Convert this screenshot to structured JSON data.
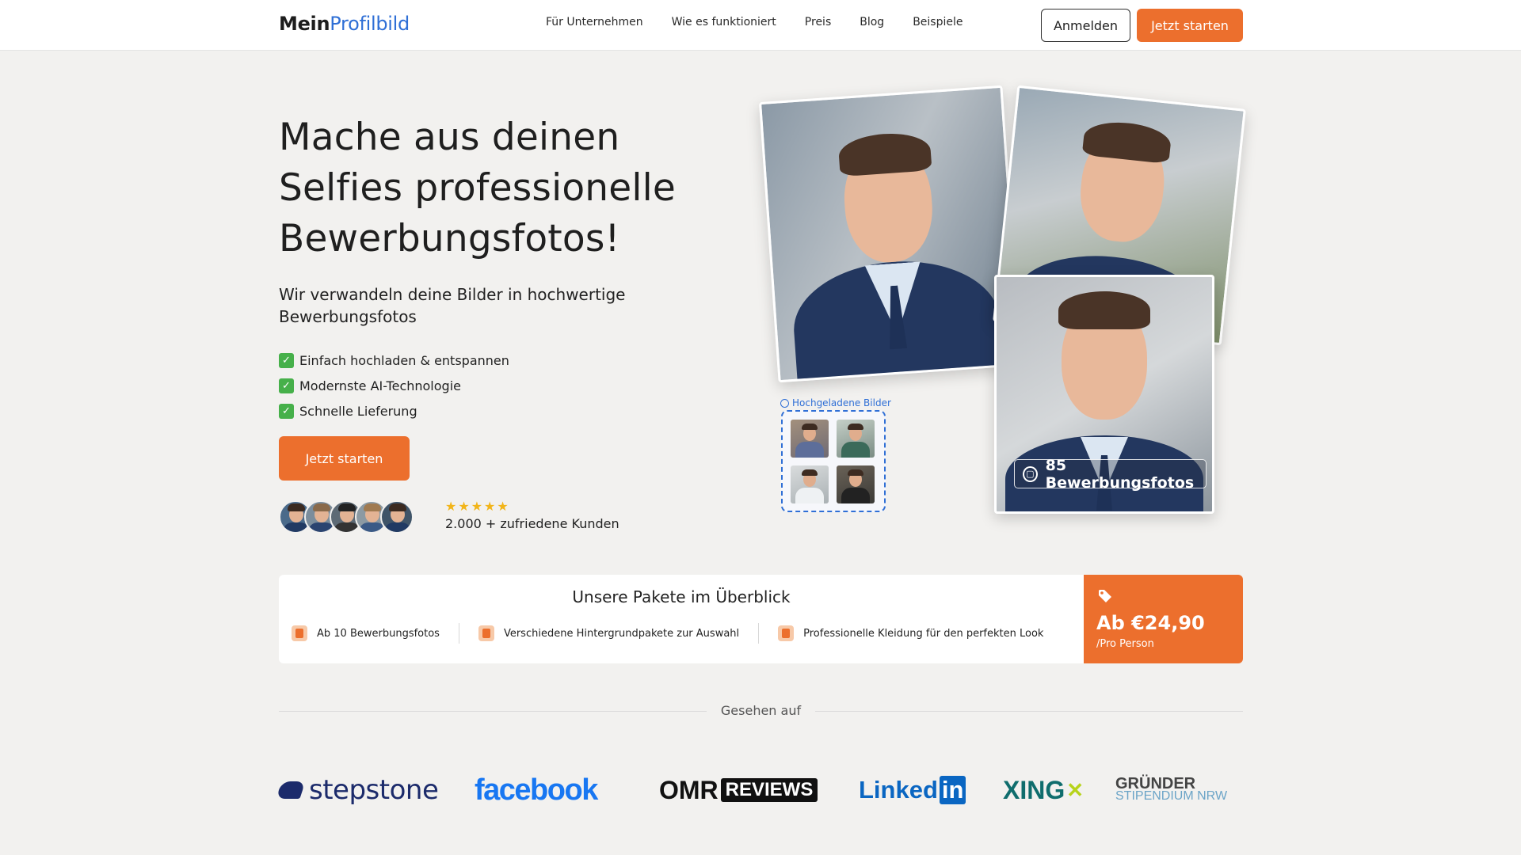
{
  "header": {
    "logo_part1": "Mein",
    "logo_part2": "Profilbild",
    "nav": [
      {
        "label": "Für Unternehmen"
      },
      {
        "label": "Wie es funktioniert"
      },
      {
        "label": "Preis"
      },
      {
        "label": "Blog"
      },
      {
        "label": "Beispiele"
      }
    ],
    "login_label": "Anmelden",
    "start_label": "Jetzt starten"
  },
  "hero": {
    "title": "Mache aus deinen Selfies professionelle Bewerbungsfotos!",
    "subtitle": "Wir verwandeln deine Bilder in hochwertige Bewerbungsfotos",
    "features": [
      {
        "icon": "checkmark-icon",
        "label": "Einfach hochladen & entspannen"
      },
      {
        "icon": "checkmark-icon",
        "label": "Modernste AI-Technologie"
      },
      {
        "icon": "checkmark-icon",
        "label": "Schnelle Lieferung"
      }
    ],
    "cta_label": "Jetzt starten",
    "rating_stars": 5,
    "rating_text": "2.000 + zufriedene Kunden"
  },
  "collage": {
    "uploads_label": "Hochgeladene Bilder",
    "result_badge": "85 Bewerbungsfotos"
  },
  "packages": {
    "title": "Unsere Pakete im Überblick",
    "items": [
      {
        "icon": "person-icon",
        "label": "Ab 10 Bewerbungsfotos"
      },
      {
        "icon": "backgrounds-icon",
        "label": "Verschiedene Hintergrundpakete zur Auswahl"
      },
      {
        "icon": "clothing-icon",
        "label": "Professionelle Kleidung für den perfekten Look"
      }
    ],
    "price": "Ab €24,90",
    "price_unit": "/Pro Person"
  },
  "seen_on": {
    "label": "Gesehen auf",
    "logos": {
      "stepstone": "stepstone",
      "facebook": "facebook",
      "omr": "OMR",
      "omr_reviews": "REVIEWS",
      "linkedin": "Linked",
      "linkedin_in": "in",
      "xing": "XING",
      "gruender_1": "GRÜNDER",
      "gruender_2": "STIPENDIUM NRW"
    }
  },
  "colors": {
    "accent": "#ec6f2d",
    "brand_blue": "#2f6fd6",
    "background": "#f2f1ef"
  }
}
